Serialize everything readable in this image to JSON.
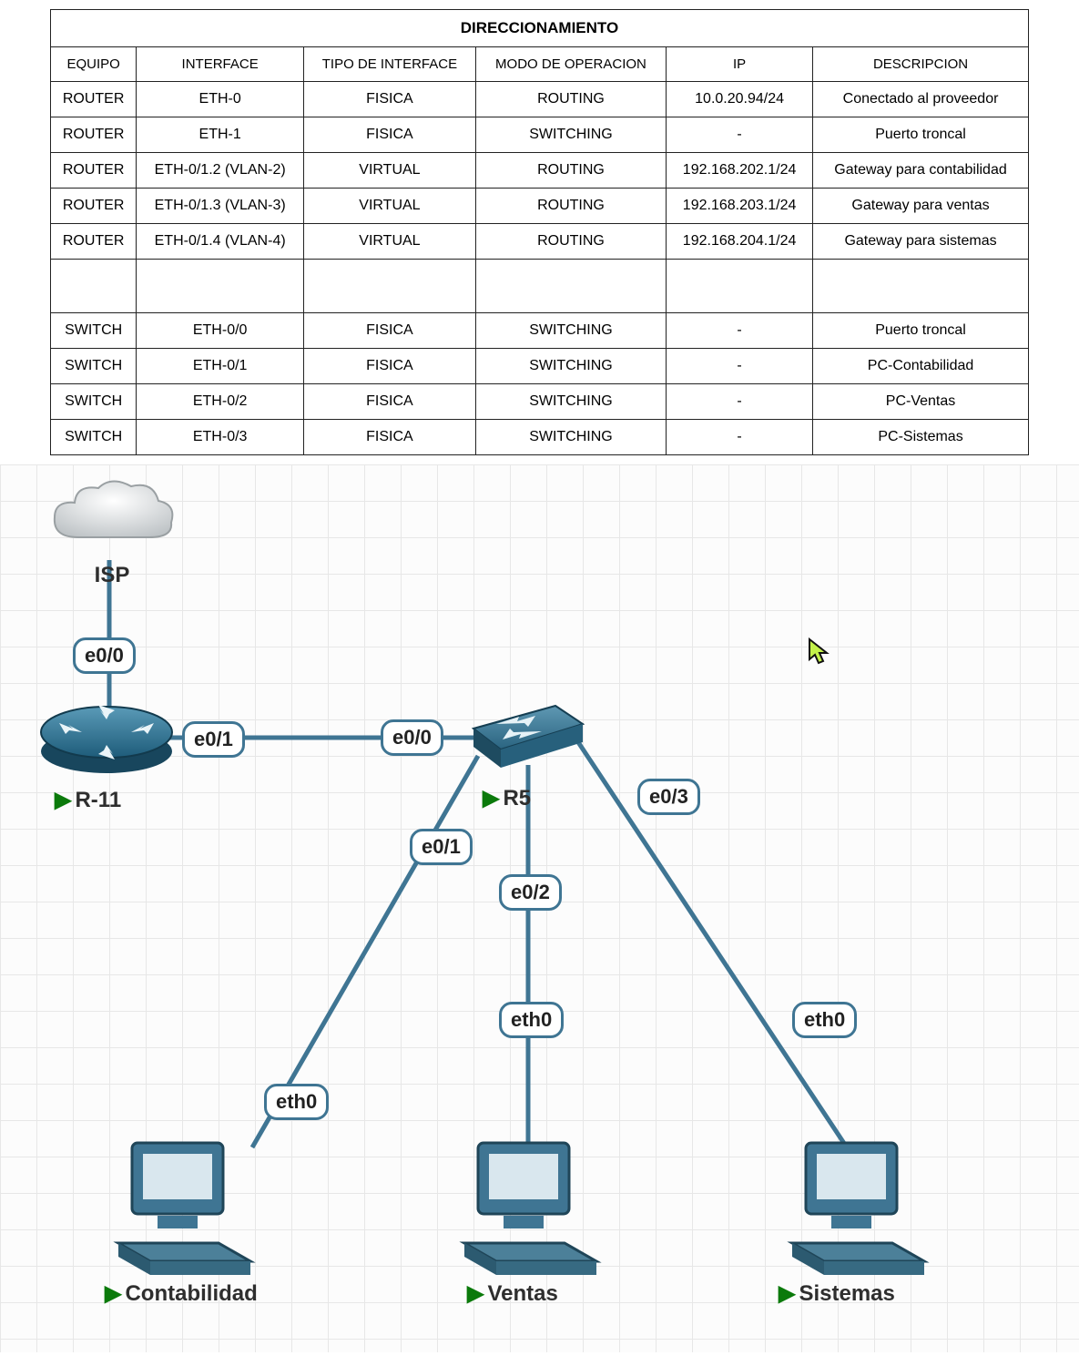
{
  "table": {
    "title": "DIRECCIONAMIENTO",
    "headers": [
      "EQUIPO",
      "INTERFACE",
      "TIPO DE INTERFACE",
      "MODO DE OPERACION",
      "IP",
      "DESCRIPCION"
    ],
    "rows": [
      [
        "ROUTER",
        "ETH-0",
        "FISICA",
        "ROUTING",
        "10.0.20.94/24",
        "Conectado al proveedor"
      ],
      [
        "ROUTER",
        "ETH-1",
        "FISICA",
        "SWITCHING",
        "-",
        "Puerto troncal"
      ],
      [
        "ROUTER",
        "ETH-0/1.2 (VLAN-2)",
        "VIRTUAL",
        "ROUTING",
        "192.168.202.1/24",
        "Gateway para contabilidad"
      ],
      [
        "ROUTER",
        "ETH-0/1.3 (VLAN-3)",
        "VIRTUAL",
        "ROUTING",
        "192.168.203.1/24",
        "Gateway para ventas"
      ],
      [
        "ROUTER",
        "ETH-0/1.4 (VLAN-4)",
        "VIRTUAL",
        "ROUTING",
        "192.168.204.1/24",
        "Gateway para sistemas"
      ],
      [
        "",
        "",
        "",
        "",
        "",
        ""
      ],
      [
        "SWITCH",
        "ETH-0/0",
        "FISICA",
        "SWITCHING",
        "-",
        "Puerto troncal"
      ],
      [
        "SWITCH",
        "ETH-0/1",
        "FISICA",
        "SWITCHING",
        "-",
        "PC-Contabilidad"
      ],
      [
        "SWITCH",
        "ETH-0/2",
        "FISICA",
        "SWITCHING",
        "-",
        "PC-Ventas"
      ],
      [
        "SWITCH",
        "ETH-0/3",
        "FISICA",
        "SWITCHING",
        "-",
        "PC-Sistemas"
      ]
    ]
  },
  "diagram": {
    "nodes": {
      "isp": {
        "label": "ISP"
      },
      "router": {
        "label": "R-11"
      },
      "switch": {
        "label": "R5"
      },
      "pc1": {
        "label": "Contabilidad"
      },
      "pc2": {
        "label": "Ventas"
      },
      "pc3": {
        "label": "Sistemas"
      }
    },
    "ports": {
      "r_e00": "e0/0",
      "r_e01": "e0/1",
      "s_e00": "e0/0",
      "s_e01": "e0/1",
      "s_e02": "e0/2",
      "s_e03": "e0/3",
      "p1_eth": "eth0",
      "p2_eth": "eth0",
      "p3_eth": "eth0"
    }
  }
}
